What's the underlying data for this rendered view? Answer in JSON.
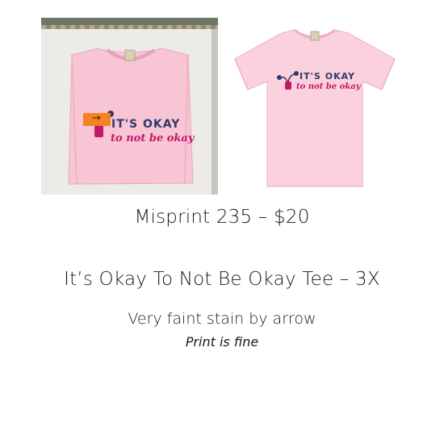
{
  "folded_photo": {
    "print_line1": "IT'S OKAY",
    "print_line2": "to not be okay",
    "tag_arrow": "→"
  },
  "flat_photo": {
    "print_line1": "IT'S OKAY",
    "print_line2": "to not be okay"
  },
  "listing": {
    "price_line": "Misprint 235 – $20",
    "name_line": "It’s Okay To Not Be Okay Tee – 3X",
    "note_line": "Very faint stain by arrow",
    "sub_note": "Print is fine"
  },
  "colors": {
    "shirt": "#f6c4d2",
    "print_navy": "#2e3a6e",
    "print_magenta": "#c2186b",
    "tag_orange": "#f58220"
  }
}
